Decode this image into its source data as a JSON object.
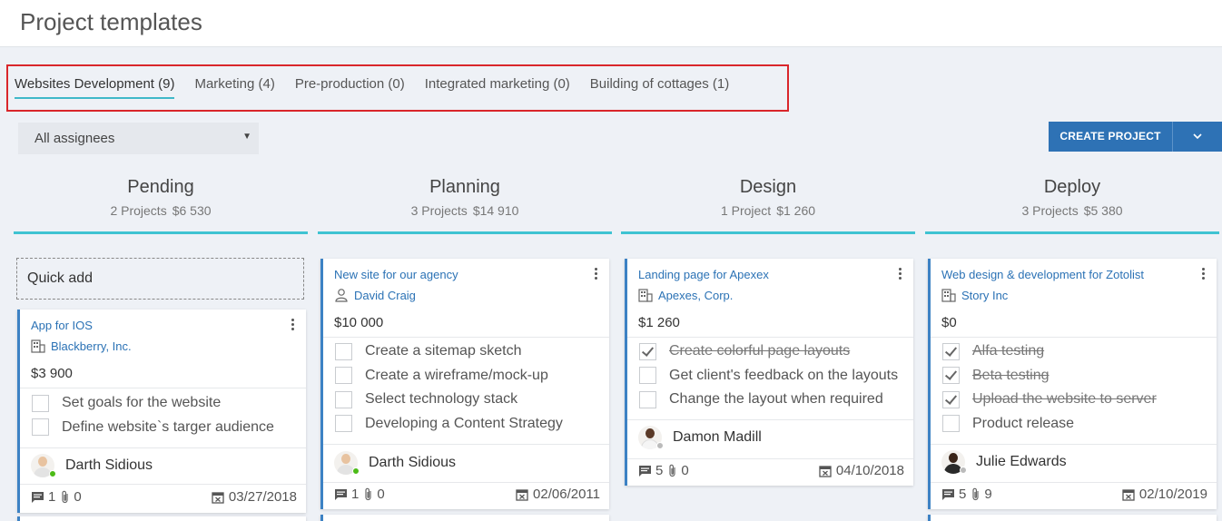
{
  "page": {
    "title": "Project templates"
  },
  "tabs": [
    {
      "label": "Websites Development (9)",
      "active": true
    },
    {
      "label": "Marketing (4)"
    },
    {
      "label": "Pre-production (0)"
    },
    {
      "label": "Integrated marketing (0)"
    },
    {
      "label": "Building of cottages (1)"
    }
  ],
  "filter": {
    "assignee_value": "All assignees"
  },
  "toolbar": {
    "create_label": "CREATE PROJECT"
  },
  "quick_add": {
    "label": "Quick add"
  },
  "colors": {
    "accent": "#3fc3d2",
    "primary": "#2e72b5",
    "link": "#2b72b5",
    "highlight_border": "#d9262b",
    "online": "#4cbb17"
  },
  "columns": [
    {
      "name": "Pending",
      "projects": "2 Projects",
      "total": "$6 530",
      "cards": [
        {
          "title": "App for IOS",
          "client_icon": "building-icon",
          "client": "Blackberry, Inc.",
          "amount": "$3 900",
          "tasks": [
            {
              "text": "Set goals for the website",
              "done": false
            },
            {
              "text": "Define website`s targer audience",
              "done": false
            }
          ],
          "assignee": "Darth Sidious",
          "comments": "1",
          "attachments": "0",
          "date": "03/27/2018"
        }
      ]
    },
    {
      "name": "Planning",
      "projects": "3 Projects",
      "total": "$14 910",
      "cards": [
        {
          "title": "New site for our agency",
          "client_icon": "person-icon",
          "client": "David Craig",
          "amount": "$10 000",
          "tasks": [
            {
              "text": "Create a sitemap sketch",
              "done": false
            },
            {
              "text": "Create a wireframe/mock-up",
              "done": false
            },
            {
              "text": "Select technology stack",
              "done": false
            },
            {
              "text": "Developing a Content Strategy",
              "done": false
            }
          ],
          "assignee": "Darth Sidious",
          "comments": "1",
          "attachments": "0",
          "date": "02/06/2011"
        }
      ]
    },
    {
      "name": "Design",
      "projects": "1 Project",
      "total": "$1 260",
      "cards": [
        {
          "title": "Landing page for Apexex",
          "client_icon": "building-icon",
          "client": "Apexes, Corp.",
          "amount": "$1 260",
          "tasks": [
            {
              "text": "Create colorful page layouts",
              "done": true
            },
            {
              "text": "Get client's feedback on the layouts",
              "done": false
            },
            {
              "text": "Change the layout when required",
              "done": false
            }
          ],
          "assignee": "Damon Madill",
          "comments": "5",
          "attachments": "0",
          "date": "04/10/2018"
        }
      ]
    },
    {
      "name": "Deploy",
      "projects": "3 Projects",
      "total": "$5 380",
      "cards": [
        {
          "title": "Web design & development for Zotolist",
          "client_icon": "building-icon",
          "client": "Story Inc",
          "amount": "$0",
          "tasks": [
            {
              "text": "Alfa testing",
              "done": true
            },
            {
              "text": "Beta testing",
              "done": true
            },
            {
              "text": "Upload the website to server",
              "done": true
            },
            {
              "text": "Product release",
              "done": false
            }
          ],
          "assignee": "Julie Edwards",
          "comments": "5",
          "attachments": "9",
          "date": "02/10/2019"
        }
      ]
    }
  ]
}
